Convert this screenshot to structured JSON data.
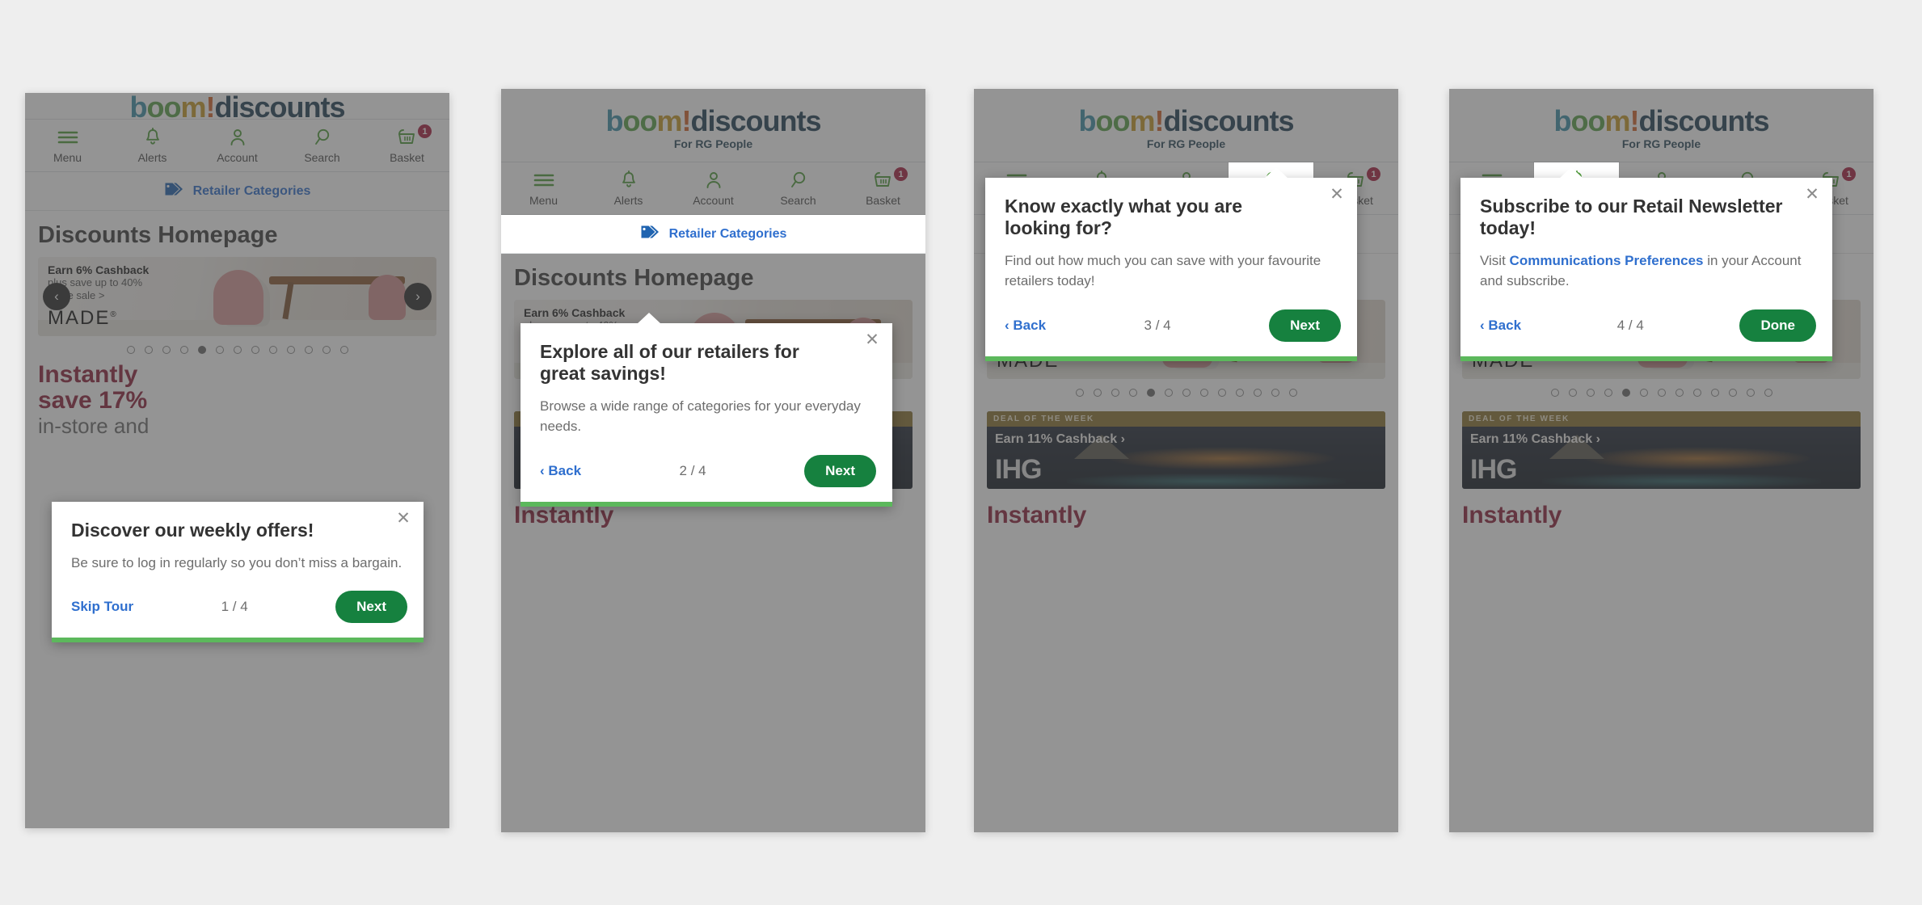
{
  "brand": {
    "logo_boom": "boom",
    "logo_b": "b",
    "logo_o1": "o",
    "logo_o2": "o",
    "logo_m": "m",
    "logo_bang": "!",
    "logo_discounts": "discounts",
    "tagline": "For RG People",
    "colors": {
      "logo_b": "#3d8fa8",
      "logo_o": "#5aa049",
      "logo_m": "#c59a27",
      "logo_bang": "#d2622a",
      "logo_discounts": "#1f3f54",
      "link_blue": "#2f6fce",
      "green_button": "#16813f",
      "green_progress": "#5cb85c",
      "badge_red": "#a81d3f",
      "nav_icon_green": "#4f9c3a"
    }
  },
  "nav": {
    "items": [
      {
        "label": "Menu",
        "icon": "hamburger-icon"
      },
      {
        "label": "Alerts",
        "icon": "bell-icon"
      },
      {
        "label": "Account",
        "icon": "person-icon"
      },
      {
        "label": "Search",
        "icon": "search-icon"
      },
      {
        "label": "Basket",
        "icon": "basket-icon",
        "badge": "1"
      }
    ]
  },
  "retailer_categories": {
    "label": "Retailer Categories",
    "icon": "tag-icon"
  },
  "page": {
    "title": "Discounts Homepage"
  },
  "hero": {
    "headline": "Earn 6% Cashback",
    "subline_1": "plus save up to 40%",
    "subline_2": "in the sale  >",
    "retailer": "MADE",
    "retailer_mark": "®",
    "prev_icon": "chevron-left-icon",
    "next_icon": "chevron-right-icon",
    "prev_glyph": "‹",
    "next_glyph": "›",
    "dots_total": 13,
    "dots_active_index": 5
  },
  "promo": {
    "line1": "Instantly",
    "line2": "save 17%",
    "line3": "in-store and"
  },
  "deal": {
    "ribbon": "DEAL OF THE WEEK",
    "cashback": "Earn 11% Cashback  ›",
    "brand": "IHG"
  },
  "tour": {
    "close_glyph": "✕",
    "back_glyph": "‹",
    "steps": [
      {
        "title": "Discover our weekly offers!",
        "body": "Be sure to log in regularly so you don’t miss a bargain.",
        "left_label": "Skip Tour",
        "left_kind": "skip",
        "counter": "1 / 4",
        "next_label": "Next",
        "anchor": "none"
      },
      {
        "title": "Explore all of our retailers for great savings!",
        "body": "Browse a wide range of categories for your everyday needs.",
        "left_label": "Back",
        "left_kind": "back",
        "counter": "2 / 4",
        "next_label": "Next",
        "anchor": "retailer-categories"
      },
      {
        "title": "Know exactly what you are looking for?",
        "body": "Find out how much you can save with your favourite retailers today!",
        "left_label": "Back",
        "left_kind": "back",
        "counter": "3 / 4",
        "next_label": "Next",
        "anchor": "search"
      },
      {
        "title": "Subscribe to our Retail Newsletter today!",
        "body_before": "Visit ",
        "body_link": "Communications Preferences",
        "body_after": " in your Account and subscribe.",
        "left_label": "Back",
        "left_kind": "back",
        "counter": "4 / 4",
        "next_label": "Done",
        "anchor": "alerts"
      }
    ]
  }
}
